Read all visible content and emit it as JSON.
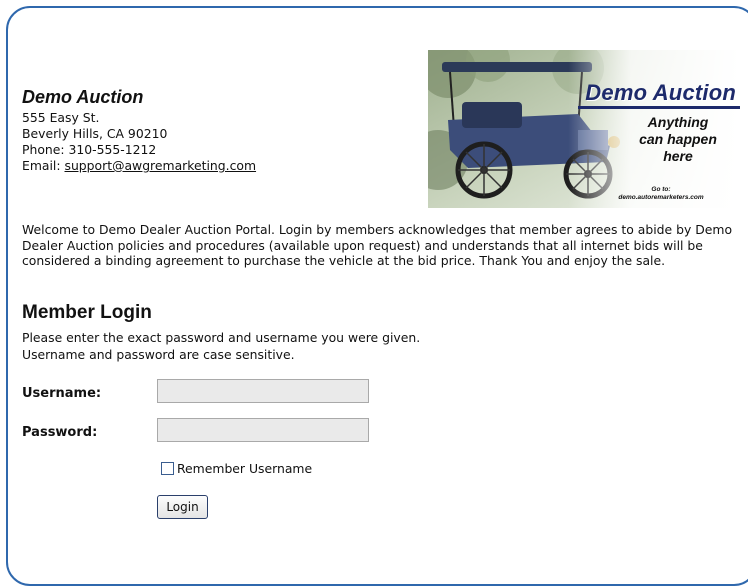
{
  "company": {
    "name": "Demo Auction",
    "address_line1": "555 Easy St.",
    "address_line2": "Beverly Hills, CA 90210",
    "phone": "Phone: 310-555-1212",
    "email_prefix": "Email: ",
    "email": "support@awgremarketing.com"
  },
  "banner": {
    "title": "Demo Auction",
    "tagline_1": "Anything",
    "tagline_2": "can happen",
    "tagline_3": "here",
    "goto_label": "Go to:",
    "goto_url": "demo.autoremarketers.com"
  },
  "welcome_text": "Welcome to Demo Dealer Auction Portal. Login by members acknowledges that member agrees to abide by Demo Dealer Auction policies and procedures (available upon request) and understands that all internet bids will be considered a binding agreement to purchase the vehicle at the bid price. Thank You and enjoy the sale.",
  "login": {
    "heading": "Member Login",
    "instruction_1": "Please enter the exact password and username you were given.",
    "instruction_2": "Username and password are case sensitive.",
    "username_label": "Username:",
    "username_value": "",
    "password_label": "Password:",
    "password_value": "",
    "remember_label": "Remember Username",
    "remember_checked": false,
    "button_label": "Login"
  },
  "colors": {
    "frame_border": "#2f68ad",
    "input_bg": "#eaeaea"
  }
}
